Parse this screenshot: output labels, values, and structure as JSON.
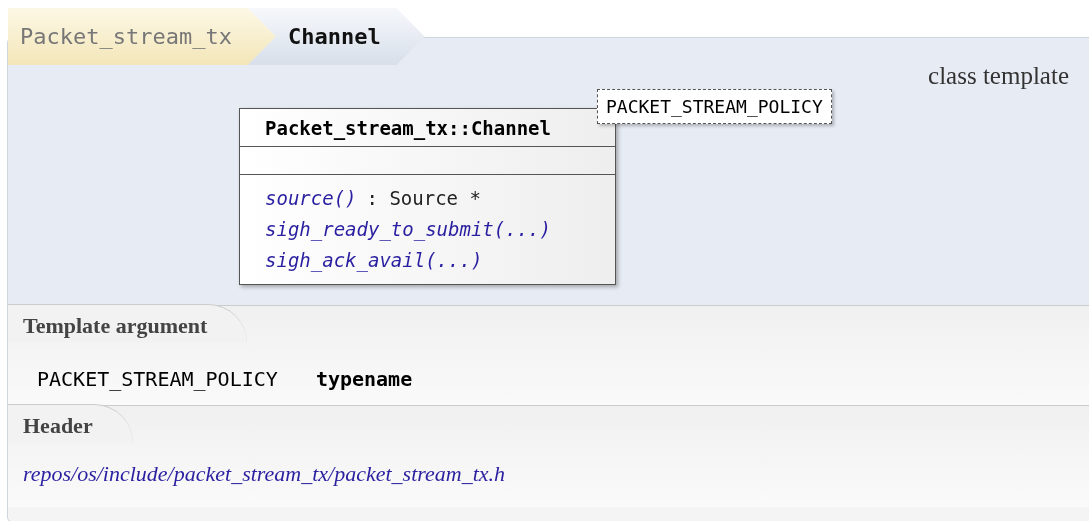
{
  "breadcrumb": [
    {
      "label": "Packet_stream_tx",
      "selected": false
    },
    {
      "label": "Channel",
      "selected": true
    }
  ],
  "kind_label": "class template",
  "class_box": {
    "title": "Packet_stream_tx::Channel",
    "template_parameter": "PACKET_STREAM_POLICY",
    "members": [
      {
        "name": "source()",
        "type": ": Source *"
      },
      {
        "name": "sigh_ready_to_submit(...)"
      },
      {
        "name": "sigh_ack_avail(...)"
      }
    ]
  },
  "template_argument": {
    "heading": "Template argument",
    "name": "PACKET_STREAM_POLICY",
    "type": "typename"
  },
  "header": {
    "heading": "Header",
    "path": "repos/os/include/packet_stream_tx/packet_stream_tx.h"
  }
}
